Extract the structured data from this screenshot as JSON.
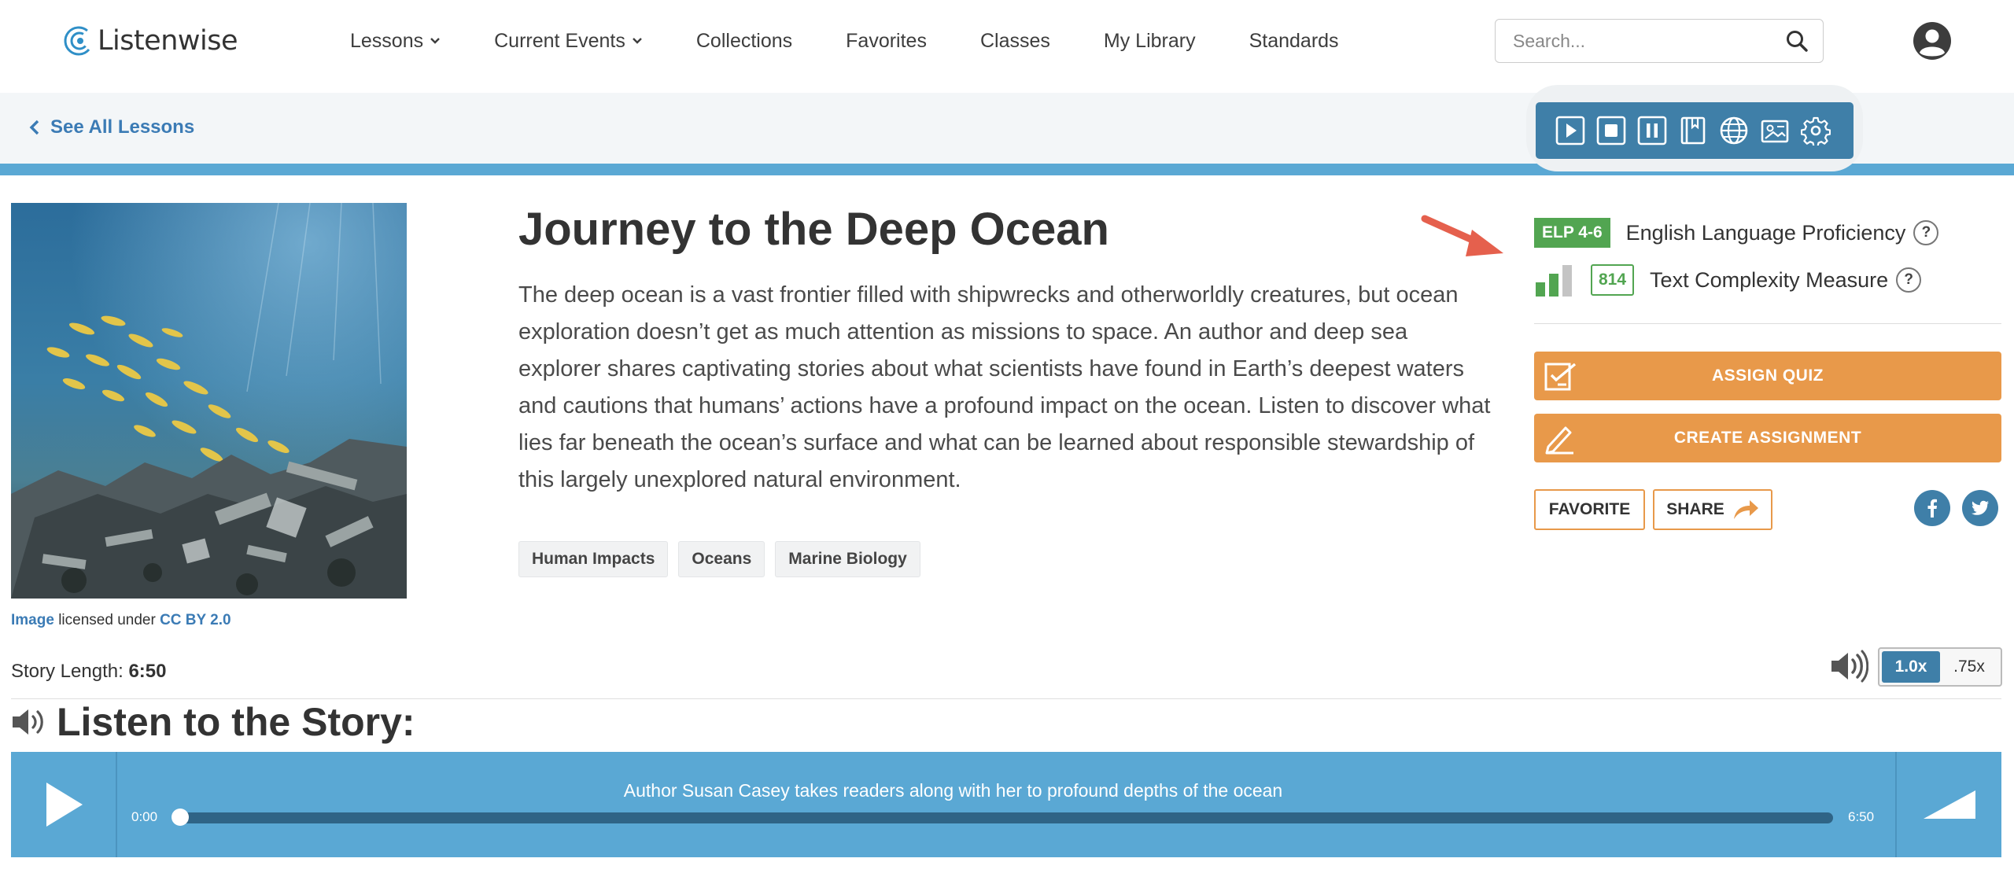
{
  "brand": {
    "name": "Listenwise"
  },
  "nav": {
    "items": [
      {
        "label": "Lessons",
        "dropdown": true
      },
      {
        "label": "Current Events",
        "dropdown": true
      },
      {
        "label": "Collections",
        "dropdown": false
      },
      {
        "label": "Favorites",
        "dropdown": false
      },
      {
        "label": "Classes",
        "dropdown": false
      },
      {
        "label": "My Library",
        "dropdown": false
      },
      {
        "label": "Standards",
        "dropdown": false
      }
    ],
    "search": {
      "placeholder": "Search...",
      "value": ""
    }
  },
  "subbar": {
    "back_label": "See All Lessons"
  },
  "tts_toolbar": {
    "icons": [
      "play-icon",
      "stop-icon",
      "pause-icon",
      "dictionary-icon",
      "translate-icon",
      "picture-dictionary-icon",
      "settings-icon"
    ]
  },
  "lesson": {
    "title": "Journey to the Deep Ocean",
    "description": "The deep ocean is a vast frontier filled with shipwrecks and otherworldly creatures, but ocean exploration doesn’t get as much attention as missions to space. An author and deep sea explorer shares captivating stories about what scientists have found in Earth’s deepest waters and cautions that humans’ actions have a profound impact on the ocean. Listen to discover what lies far beneath the ocean’s surface and what can be learned about responsible stewardship of this largely unexplored natural environment.",
    "tags": [
      "Human Impacts",
      "Oceans",
      "Marine Biology"
    ],
    "image_credit": {
      "image_link": "Image",
      "middle": " licensed under ",
      "license_link": "CC BY 2.0"
    }
  },
  "proficiency": {
    "elp_badge": "ELP 4-6",
    "elp_label": "English Language Proficiency",
    "tc_badge": "814",
    "tc_label": "Text Complexity Measure",
    "help": "?"
  },
  "actions": {
    "assign_quiz": "ASSIGN QUIZ",
    "create_assignment": "CREATE ASSIGNMENT",
    "favorite": "FAVORITE",
    "share": "SHARE"
  },
  "story": {
    "length_label": "Story Length: ",
    "length_value": "6:50",
    "listen_heading": "Listen to the Story:",
    "speed_options": [
      "1.0x",
      ".75x"
    ],
    "speed_selected": "1.0x"
  },
  "player": {
    "track_title": "Author Susan Casey takes readers along with her to profound depths of the ocean",
    "time_current": "0:00",
    "time_total": "6:50",
    "progress": 0
  },
  "colors": {
    "accent_blue": "#3f7fa8",
    "player_blue": "#5aa8d4",
    "link_blue": "#3b7bb5",
    "orange": "#e8994a",
    "green": "#52a551",
    "arrow_red": "#e5604d"
  }
}
